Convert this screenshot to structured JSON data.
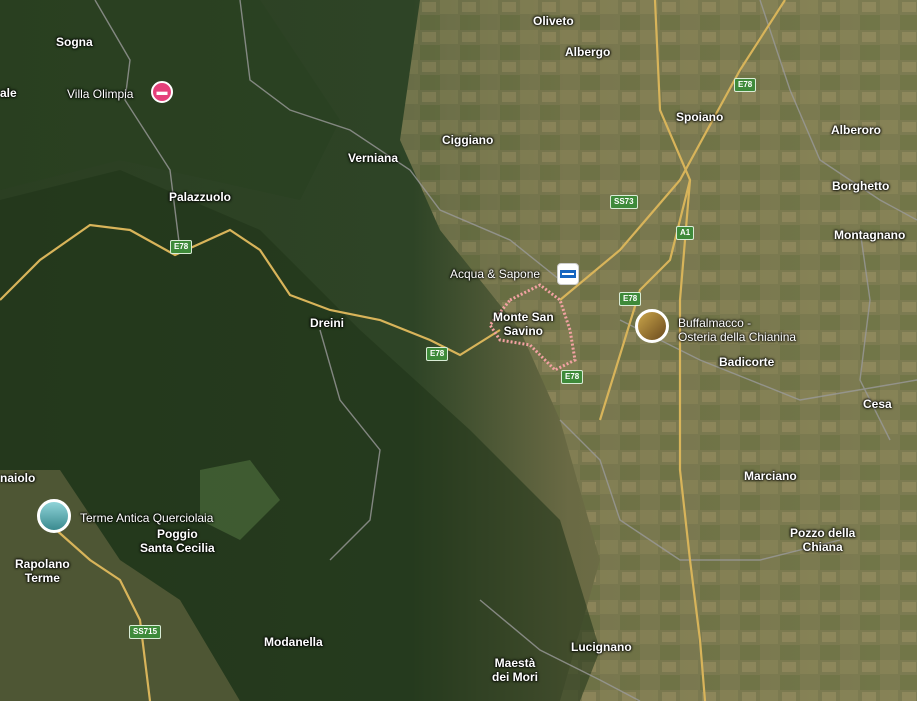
{
  "places": {
    "sogna": "Sogna",
    "ale": "ale",
    "villa_olimpia": "Villa Olimpia",
    "oliveto": "Oliveto",
    "albergo": "Albergo",
    "spoiano": "Spoiano",
    "alberoro": "Alberoro",
    "ciggiano": "Ciggiano",
    "verniana": "Verniana",
    "borghetto": "Borghetto",
    "palazzuolo": "Palazzuolo",
    "montagnano": "Montagnano",
    "acqua_sapone": "Acqua & Sapone",
    "dreini": "Dreini",
    "monte_san_savino_1": "Monte San",
    "monte_san_savino_2": "Savino",
    "buffalmacco_1": "Buffalmacco -",
    "buffalmacco_2": "Osteria della Chianina",
    "badicorte": "Badicorte",
    "cesa": "Cesa",
    "maiolo": "naiolo",
    "marciano": "Marciano",
    "terme": "Terme Antica Querciolaia",
    "poggio_1": "Poggio",
    "poggio_2": "Santa Cecilia",
    "pozzo_1": "Pozzo della",
    "pozzo_2": "Chiana",
    "rapolano_1": "Rapolano",
    "rapolano_2": "Terme",
    "modanella": "Modanella",
    "lucignano": "Lucignano",
    "maesta_1": "Maestà",
    "maesta_2": "dei Mori"
  },
  "roads": {
    "e78_a": "E78",
    "e78_b": "E78",
    "e78_c": "E78",
    "e78_d": "E78",
    "e78_e": "E78",
    "ss73": "SS73",
    "a1": "A1",
    "ss715": "SS715"
  },
  "icons": {
    "hotel": "hotel-icon",
    "shop": "shop-icon",
    "restaurant_photo": "restaurant-photo",
    "spa_photo": "spa-photo"
  },
  "colors": {
    "road": "#d8b45a",
    "hotel_pin": "#e5407a",
    "road_shield": "#3e8a3a"
  }
}
